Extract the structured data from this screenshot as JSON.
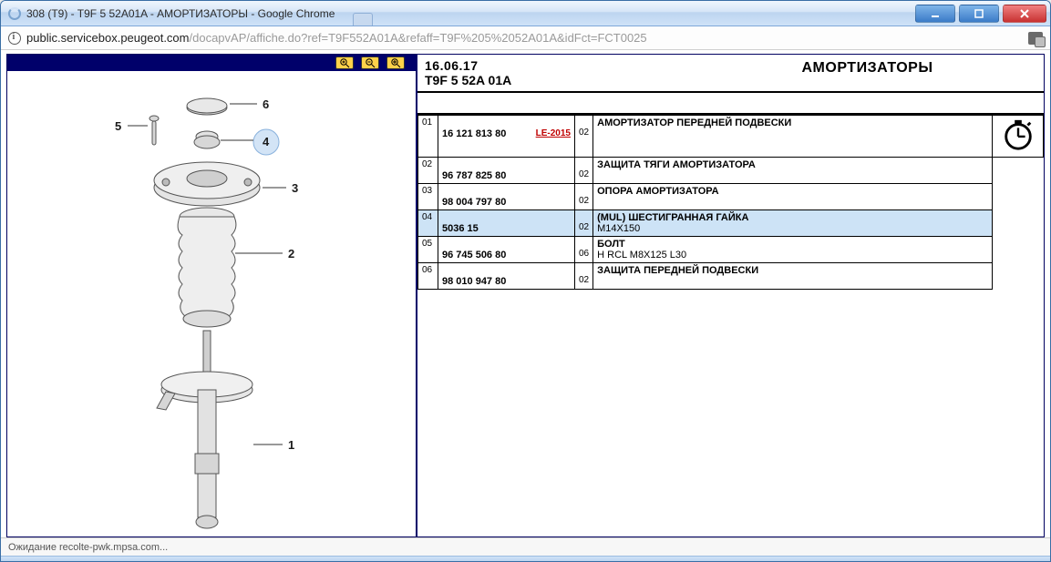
{
  "window": {
    "title": "308 (T9) - T9F 5 52A01A - АМОРТИЗАТОРЫ - Google Chrome",
    "url_host": "public.servicebox.peugeot.com",
    "url_path": "/docapvAP/affiche.do?ref=T9F552A01A&refaff=T9F%205%2052A01A&idFct=FCT0025"
  },
  "header": {
    "date": "16.06.17",
    "code_pre": "T9F 5 ",
    "code_bold": "52A",
    "code_post": " 01A",
    "title": "АМОРТИЗАТОРЫ"
  },
  "rows": [
    {
      "idx": "01",
      "pn": "16 121 813 80",
      "le": "LE-2015",
      "qty": "02",
      "desc": "АМОРТИЗАТОР ПЕРЕДНЕЙ ПОДВЕСКИ",
      "sub": "",
      "sel": false,
      "clock": true
    },
    {
      "idx": "02",
      "pn": "96 787 825 80",
      "le": "",
      "qty": "02",
      "desc": "ЗАЩИТА ТЯГИ АМОРТИЗАТОРА",
      "sub": "",
      "sel": false,
      "clock": false
    },
    {
      "idx": "03",
      "pn": "98 004 797 80",
      "le": "",
      "qty": "02",
      "desc": "ОПОРА АМОРТИЗАТОРА",
      "sub": "",
      "sel": false,
      "clock": false
    },
    {
      "idx": "04",
      "pn": "5036 15",
      "le": "",
      "qty": "02",
      "desc": "(MUL) ШЕСТИГРАННАЯ ГАЙКА",
      "sub": "M14X150",
      "sel": true,
      "clock": false
    },
    {
      "idx": "05",
      "pn": "96 745 506 80",
      "le": "",
      "qty": "06",
      "desc": "БОЛТ",
      "sub": "H RCL M8X125 L30",
      "sel": false,
      "clock": false
    },
    {
      "idx": "06",
      "pn": "98 010 947 80",
      "le": "",
      "qty": "02",
      "desc": "ЗАЩИТА ПЕРЕДНЕЙ ПОДВЕСКИ",
      "sub": "",
      "sel": false,
      "clock": false
    }
  ],
  "callouts": [
    "1",
    "2",
    "3",
    "4",
    "5",
    "6"
  ],
  "status": "Ожидание recolte-pwk.mpsa.com..."
}
